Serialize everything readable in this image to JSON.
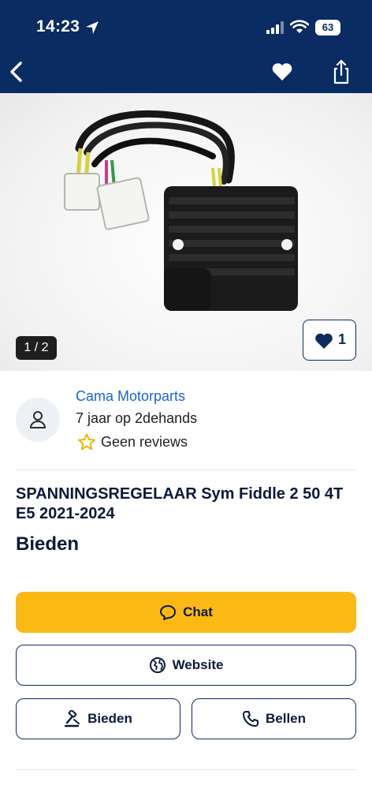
{
  "status_bar": {
    "time": "14:23",
    "battery": "63"
  },
  "gallery": {
    "counter": "1 / 2",
    "favorites_count": "1"
  },
  "seller": {
    "name": "Cama Motorparts",
    "since": "7 jaar op 2dehands",
    "reviews": "Geen reviews"
  },
  "listing": {
    "title": "SPANNINGSREGELAAR Sym Fiddle 2 50 4T E5 2021-2024",
    "price": "Bieden"
  },
  "actions": {
    "chat": "Chat",
    "website": "Website",
    "bid": "Bieden",
    "call": "Bellen"
  },
  "colors": {
    "header": "#0b2b63",
    "primary_button": "#fcb813",
    "link": "#1a66cc"
  },
  "icons": [
    "location-arrow-icon",
    "signal-icon",
    "wifi-icon",
    "back-icon",
    "heart-icon",
    "share-icon",
    "user-icon",
    "star-icon",
    "chat-icon",
    "globe-icon",
    "auction-icon",
    "phone-icon"
  ]
}
